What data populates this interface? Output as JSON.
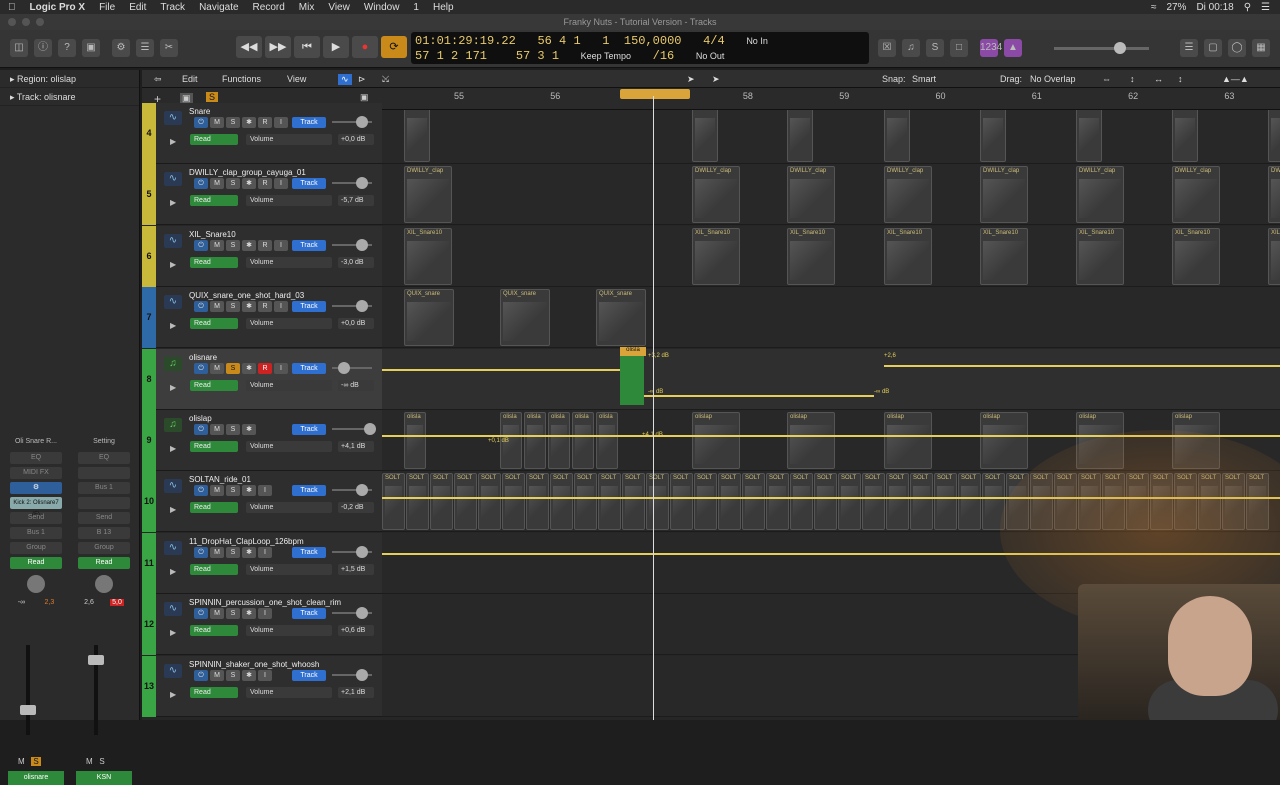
{
  "menubar": {
    "app": "Logic Pro X",
    "items": [
      "File",
      "Edit",
      "Track",
      "Navigate",
      "Record",
      "Mix",
      "View",
      "Window",
      "1",
      "Help"
    ],
    "battery": "27%",
    "clock": "Di 00:18"
  },
  "window_title": "Franky Nuts - Tutorial Version - Tracks",
  "lcd": {
    "time": "01:01:29:19.22",
    "bars_top": "56 4 1",
    "bars_top2": "1",
    "tempo": "150,0000",
    "sig": "4/4",
    "in": "No In",
    "bars_bottom": "57 1 2 171",
    "bars_bottom2": "57 3 1",
    "keep": "Keep Tempo",
    "div": "/16",
    "out": "No Out"
  },
  "inspector": {
    "region_label": "Region: olislap",
    "track_label": "Track: olisnare",
    "strip1": {
      "name": "Oli Snare R...",
      "bus": "Bus 1",
      "read": "Read",
      "db1": "-∞",
      "db2": "2,3",
      "bottom": "olisnare",
      "tooltip": "Kick 2: Olisnare7 (F)"
    },
    "strip2": {
      "name": "Setting",
      "bus": "B 13",
      "read": "Read",
      "db1": "2,6",
      "db2": "5,0",
      "bottom": "KSN",
      "top": "Bus 1"
    }
  },
  "lanebar": {
    "edit": "Edit",
    "functions": "Functions",
    "view": "View",
    "snap_label": "Snap:",
    "snap_value": "Smart",
    "drag_label": "Drag:",
    "drag_value": "No Overlap"
  },
  "ruler": {
    "bars": [
      "55",
      "56",
      "57",
      "58",
      "59",
      "60",
      "61",
      "62",
      "63"
    ]
  },
  "tracks": [
    {
      "num": "4",
      "name": "Snare",
      "db": "+0,0 dB",
      "color": "#c9b93a",
      "mode": "Read",
      "param": "Volume",
      "track_btn": "Track"
    },
    {
      "num": "5",
      "name": "DWILLY_clap_group_cayuga_01",
      "db": "-5,7 dB",
      "color": "#c9b93a",
      "mode": "Read",
      "param": "Volume",
      "track_btn": "Track"
    },
    {
      "num": "6",
      "name": "XIL_Snare10",
      "db": "-3,0 dB",
      "color": "#c9b93a",
      "mode": "Read",
      "param": "Volume",
      "track_btn": "Track"
    },
    {
      "num": "7",
      "name": "QUIX_snare_one_shot_hard_03",
      "db": "+0,0 dB",
      "color": "#2f6aa8",
      "mode": "Read",
      "param": "Volume",
      "track_btn": "Track"
    },
    {
      "num": "8",
      "name": "olisnare",
      "db": "-∞ dB",
      "color": "#3aa545",
      "mode": "Read",
      "param": "Volume",
      "track_btn": "Track"
    },
    {
      "num": "9",
      "name": "olislap",
      "db": "+4,1 dB",
      "color": "#3aa545",
      "mode": "Read",
      "param": "Volume",
      "track_btn": "Track"
    },
    {
      "num": "10",
      "name": "SOLTAN_ride_01",
      "db": "-0,2 dB",
      "color": "#3aa545",
      "mode": "Read",
      "param": "Volume",
      "track_btn": "Track"
    },
    {
      "num": "11",
      "name": "11_DropHat_ClapLoop_126bpm",
      "db": "+1,5 dB",
      "color": "#3aa545",
      "mode": "Read",
      "param": "Volume",
      "track_btn": "Track"
    },
    {
      "num": "12",
      "name": "SPINNIN_percussion_one_shot_clean_rim",
      "db": "+0,6 dB",
      "color": "#3aa545",
      "mode": "Read",
      "param": "Volume",
      "track_btn": "Track"
    },
    {
      "num": "13",
      "name": "SPINNIN_shaker_one_shot_whoosh",
      "db": "+2,1 dB",
      "color": "#3aa545",
      "mode": "Read",
      "param": "Volume",
      "track_btn": "Track"
    }
  ],
  "regions": {
    "clap": "DWILLY_clap",
    "xil": "XIL_Snare10",
    "quix": "QUIX_snare",
    "olisla": "olisla",
    "olislap": "olislap",
    "solt": "SOLT"
  },
  "automation": {
    "tag1": "+3,2 dB",
    "tag2": "+2,6",
    "tag3": "-∞ dB",
    "tag4": "-∞ dB",
    "tag5": "+0,1 dB",
    "tag6": "+4,1 dB"
  },
  "buttons": {
    "m": "M",
    "s": "S",
    "r": "R",
    "i": "I",
    "star": "✱"
  }
}
